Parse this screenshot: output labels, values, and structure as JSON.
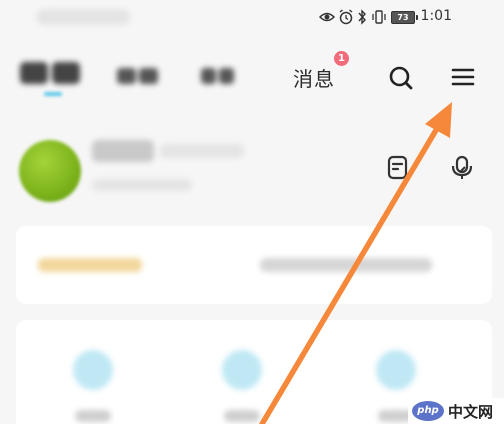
{
  "status_bar": {
    "time": "1:01",
    "battery_level": "73",
    "icons": [
      "eye-icon",
      "alarm-icon",
      "bluetooth-icon",
      "vibrate-icon",
      "battery-icon"
    ]
  },
  "top_nav": {
    "tabs": [
      {
        "label": "",
        "blurred": true,
        "selected": true
      },
      {
        "label": "",
        "blurred": true
      },
      {
        "label": "",
        "blurred": true
      },
      {
        "label": "消息",
        "badge": "1"
      }
    ],
    "icons": [
      "search-icon",
      "menu-icon"
    ]
  },
  "profile": {
    "actions": [
      "note-icon",
      "mic-icon"
    ]
  },
  "watermark": {
    "logo": "php",
    "text": "中文网"
  },
  "colors": {
    "background": "#f6f6f6",
    "card": "#ffffff",
    "badge": "#f26b7b",
    "arrow": "#f5883a",
    "tab_underline": "#5cc9e8",
    "avatar": "#8cc02a"
  }
}
